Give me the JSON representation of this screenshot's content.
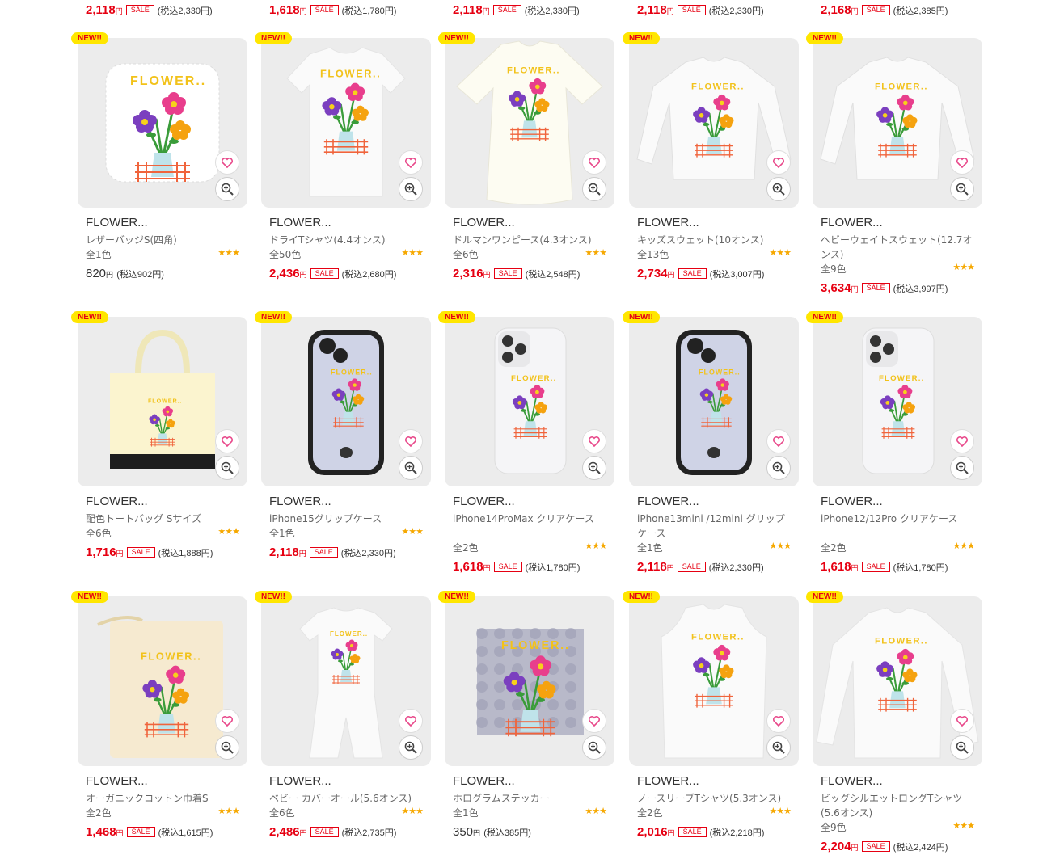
{
  "top_prices": [
    {
      "price": "2,118",
      "yen": "円",
      "sale": "SALE",
      "tax": "(税込2,330円)"
    },
    {
      "price": "1,618",
      "yen": "円",
      "sale": "SALE",
      "tax": "(税込1,780円)"
    },
    {
      "price": "2,118",
      "yen": "円",
      "sale": "SALE",
      "tax": "(税込2,330円)"
    },
    {
      "price": "2,118",
      "yen": "円",
      "sale": "SALE",
      "tax": "(税込2,330円)"
    },
    {
      "price": "2,168",
      "yen": "円",
      "sale": "SALE",
      "tax": "(税込2,385円)"
    }
  ],
  "badge_text": "NEW!!",
  "stars": "★★★",
  "products": [
    {
      "title": "FLOWER...",
      "name": "レザーバッジS(四角)",
      "colors": "全1色",
      "price": "820",
      "yen": "円",
      "sale": "",
      "tax": "(税込902円)",
      "kind": "badge"
    },
    {
      "title": "FLOWER...",
      "name": "ドライTシャツ(4.4オンス)",
      "colors": "全50色",
      "price": "2,436",
      "yen": "円",
      "sale": "SALE",
      "tax": "(税込2,680円)",
      "kind": "tshirt"
    },
    {
      "title": "FLOWER...",
      "name": "ドルマンワンピース(4.3オンス)",
      "colors": "全6色",
      "price": "2,316",
      "yen": "円",
      "sale": "SALE",
      "tax": "(税込2,548円)",
      "kind": "dress"
    },
    {
      "title": "FLOWER...",
      "name": "キッズスウェット(10オンス)",
      "colors": "全13色",
      "price": "2,734",
      "yen": "円",
      "sale": "SALE",
      "tax": "(税込3,007円)",
      "kind": "sweat"
    },
    {
      "title": "FLOWER...",
      "name": "ヘビーウェイトスウェット(12.7オンス)",
      "colors": "全9色",
      "price": "3,634",
      "yen": "円",
      "sale": "SALE",
      "tax": "(税込3,997円)",
      "kind": "sweat"
    },
    {
      "title": "FLOWER...",
      "name": "配色トートバッグ Sサイズ",
      "colors": "全6色",
      "price": "1,716",
      "yen": "円",
      "sale": "SALE",
      "tax": "(税込1,888円)",
      "kind": "tote"
    },
    {
      "title": "FLOWER...",
      "name": "iPhone15グリップケース",
      "colors": "全1色",
      "price": "2,118",
      "yen": "円",
      "sale": "SALE",
      "tax": "(税込2,330円)",
      "kind": "phoneblack"
    },
    {
      "title": "FLOWER...",
      "name": "iPhone14ProMax クリアケース",
      "colors": "全2色",
      "price": "1,618",
      "yen": "円",
      "sale": "SALE",
      "tax": "(税込1,780円)",
      "kind": "phoneclear"
    },
    {
      "title": "FLOWER...",
      "name": "iPhone13mini /12mini グリップケース",
      "colors": "全1色",
      "price": "2,118",
      "yen": "円",
      "sale": "SALE",
      "tax": "(税込2,330円)",
      "kind": "phoneblack"
    },
    {
      "title": "FLOWER...",
      "name": "iPhone12/12Pro クリアケース",
      "colors": "全2色",
      "price": "1,618",
      "yen": "円",
      "sale": "SALE",
      "tax": "(税込1,780円)",
      "kind": "phoneclear"
    },
    {
      "title": "FLOWER...",
      "name": "オーガニックコットン巾着S",
      "colors": "全2色",
      "price": "1,468",
      "yen": "円",
      "sale": "SALE",
      "tax": "(税込1,615円)",
      "kind": "pouch"
    },
    {
      "title": "FLOWER...",
      "name": "ベビー カバーオール(5.6オンス)",
      "colors": "全6色",
      "price": "2,486",
      "yen": "円",
      "sale": "SALE",
      "tax": "(税込2,735円)",
      "kind": "baby"
    },
    {
      "title": "FLOWER...",
      "name": "ホログラムステッカー",
      "colors": "全1色",
      "price": "350",
      "yen": "円",
      "sale": "",
      "tax": "(税込385円)",
      "kind": "holo"
    },
    {
      "title": "FLOWER...",
      "name": "ノースリーブTシャツ(5.3オンス)",
      "colors": "全2色",
      "price": "2,016",
      "yen": "円",
      "sale": "SALE",
      "tax": "(税込2,218円)",
      "kind": "sleeveless"
    },
    {
      "title": "FLOWER...",
      "name": "ビッグシルエットロングTシャツ(5.6オンス)",
      "colors": "全9色",
      "price": "2,204",
      "yen": "円",
      "sale": "SALE",
      "tax": "(税込2,424円)",
      "kind": "longsleeve"
    }
  ]
}
